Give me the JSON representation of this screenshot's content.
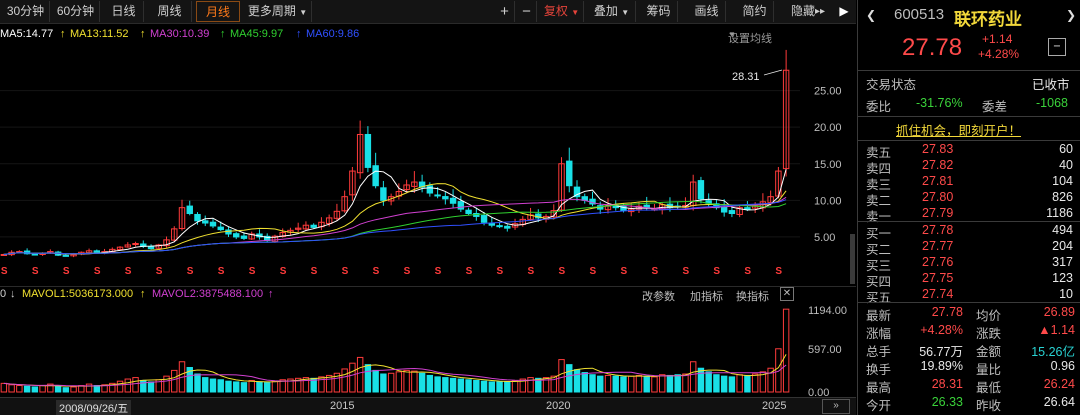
{
  "toolbar": {
    "periods": [
      "30分钟",
      "60分钟",
      "日线",
      "周线",
      "月线"
    ],
    "more_periods": "更多周期",
    "zoom_in": "+",
    "zoom_out": "−",
    "right_buttons": [
      "复权",
      "叠加",
      "筹码",
      "画线",
      "简约",
      "隐藏"
    ],
    "arrows": "▸▸"
  },
  "ma_legend": {
    "ma5": "MA5:14.77",
    "ma13": "MA13:11.52",
    "ma30": "MA30:10.39",
    "ma45": "MA45:9.97",
    "ma60": "MA60:9.86",
    "settings": "设置均线",
    "colors": {
      "ma5": "#ffffff",
      "ma13": "#f0e030",
      "ma30": "#d040d0",
      "ma45": "#30d030",
      "ma60": "#3050ff"
    }
  },
  "vol_legend": {
    "prefix": "0",
    "mavol1": "MAVOL1:5036173.000",
    "mavol2": "MAVOL2:3875488.100",
    "buttons": [
      "改参数",
      "加指标",
      "换指标"
    ]
  },
  "x_axis": {
    "cursor_date": "2008/09/26/五",
    "years": [
      "2015",
      "2020",
      "2025"
    ]
  },
  "chart_data": [
    {
      "type": "candlestick",
      "title": "",
      "y_ticks": [
        5.0,
        10.0,
        15.0,
        20.0,
        25.0
      ],
      "ylim": [
        1.3,
        30.0
      ],
      "peak_label": "28.31",
      "dividend_marker": "S",
      "closes": [
        2.6,
        2.9,
        3.0,
        2.7,
        2.6,
        2.8,
        3.0,
        2.5,
        2.4,
        2.6,
        2.9,
        3.1,
        2.8,
        3.0,
        3.3,
        3.6,
        3.9,
        4.1,
        3.7,
        3.4,
        3.9,
        4.6,
        6.1,
        9.0,
        8.2,
        7.2,
        6.9,
        6.5,
        6.0,
        5.4,
        5.0,
        4.8,
        5.4,
        5.0,
        4.5,
        5.1,
        5.6,
        5.9,
        6.2,
        6.6,
        6.3,
        7.0,
        7.6,
        8.5,
        10.5,
        14.0,
        19.0,
        14.5,
        12.0,
        10.0,
        10.5,
        11.2,
        12.1,
        12.5,
        11.8,
        11.0,
        10.6,
        10.2,
        9.6,
        8.8,
        8.2,
        7.8,
        7.0,
        6.6,
        6.4,
        6.2,
        6.8,
        7.4,
        8.0,
        7.6,
        7.8,
        8.6,
        15.0,
        12.0,
        10.5,
        10.0,
        9.5,
        8.8,
        9.2,
        9.0,
        8.6,
        8.8,
        9.2,
        9.0,
        8.8,
        9.4,
        9.0,
        9.2,
        9.3,
        12.5,
        10.2,
        9.6,
        9.0,
        8.4,
        8.2,
        9.0,
        8.8,
        9.2,
        9.8,
        10.5,
        14.0,
        27.78
      ],
      "volumes": [
        120,
        100,
        90,
        80,
        70,
        90,
        110,
        80,
        60,
        70,
        90,
        110,
        90,
        100,
        120,
        150,
        180,
        200,
        160,
        140,
        170,
        220,
        300,
        420,
        340,
        250,
        200,
        180,
        170,
        150,
        140,
        130,
        160,
        140,
        130,
        150,
        170,
        180,
        190,
        200,
        190,
        210,
        230,
        260,
        320,
        400,
        480,
        380,
        300,
        250,
        260,
        280,
        300,
        290,
        260,
        230,
        210,
        200,
        190,
        180,
        170,
        160,
        150,
        140,
        140,
        140,
        160,
        180,
        200,
        190,
        200,
        220,
        450,
        380,
        310,
        270,
        240,
        220,
        230,
        220,
        210,
        220,
        230,
        220,
        210,
        240,
        230,
        240,
        250,
        420,
        330,
        280,
        240,
        220,
        210,
        240,
        230,
        250,
        280,
        330,
        600,
        1150
      ]
    }
  ],
  "volume_axis": {
    "ticks": [
      "1194.00",
      "597.00",
      "0.00"
    ],
    "ylim": [
      0,
      1194
    ]
  },
  "stock": {
    "code": "600513",
    "name": "联环药业",
    "price": "27.78",
    "change": "+1.14",
    "change_pct": "+4.28%",
    "minus_btn": "−",
    "status_label": "交易状态",
    "status_value": "已收市",
    "weibi_label": "委比",
    "weibi_value": "-31.76%",
    "weicha_label": "委差",
    "weicha_value": "-1068",
    "promo": "抓住机会，即刻开户！"
  },
  "order_book": {
    "asks": [
      {
        "label": "卖五",
        "price": "27.83",
        "vol": "60"
      },
      {
        "label": "卖四",
        "price": "27.82",
        "vol": "40"
      },
      {
        "label": "卖三",
        "price": "27.81",
        "vol": "104"
      },
      {
        "label": "卖二",
        "price": "27.80",
        "vol": "826"
      },
      {
        "label": "卖一",
        "price": "27.79",
        "vol": "1186"
      }
    ],
    "bids": [
      {
        "label": "买一",
        "price": "27.78",
        "vol": "494"
      },
      {
        "label": "买二",
        "price": "27.77",
        "vol": "204"
      },
      {
        "label": "买三",
        "price": "27.76",
        "vol": "317"
      },
      {
        "label": "买四",
        "price": "27.75",
        "vol": "123"
      },
      {
        "label": "买五",
        "price": "27.74",
        "vol": "10"
      }
    ]
  },
  "stats": [
    {
      "l1": "最新",
      "v1": "27.78",
      "c1": "up",
      "l2": "均价",
      "v2": "26.89",
      "c2": "up"
    },
    {
      "l1": "涨幅",
      "v1": "+4.28%",
      "c1": "up",
      "l2": "涨跌",
      "v2": "▲1.14",
      "c2": "up"
    },
    {
      "l1": "总手",
      "v1": "56.77万",
      "c1": "wh",
      "l2": "金额",
      "v2": "15.26亿",
      "c2": "cy"
    },
    {
      "l1": "换手",
      "v1": "19.89%",
      "c1": "wh",
      "l2": "量比",
      "v2": "0.96",
      "c2": "wh"
    },
    {
      "l1": "最高",
      "v1": "28.31",
      "c1": "up",
      "l2": "最低",
      "v2": "26.24",
      "c2": "up"
    },
    {
      "l1": "今开",
      "v1": "26.33",
      "c1": "dn",
      "l2": "昨收",
      "v2": "26.64",
      "c2": "wh"
    }
  ]
}
